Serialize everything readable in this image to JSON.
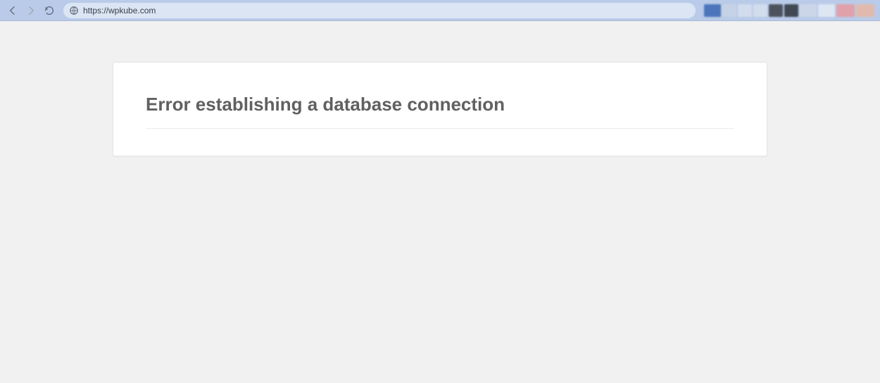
{
  "browser": {
    "url": "https://wpkube.com",
    "nav": {
      "back_label": "Back",
      "forward_label": "Forward",
      "reload_label": "Reload"
    },
    "extensions": [
      {
        "width": 24,
        "color": "#3a67b5"
      },
      {
        "width": 20,
        "color": "#c9d4e6"
      },
      {
        "width": 20,
        "color": "#d6dfee"
      },
      {
        "width": 20,
        "color": "#d6dfee"
      },
      {
        "width": 20,
        "color": "#3b3f46"
      },
      {
        "width": 20,
        "color": "#2d323a"
      },
      {
        "width": 24,
        "color": "#cfd8e8"
      },
      {
        "width": 24,
        "color": "#e4ebf5"
      },
      {
        "width": 26,
        "color": "#e89aa0"
      },
      {
        "width": 26,
        "color": "#e9b7a4"
      }
    ]
  },
  "page": {
    "error_title": "Error establishing a database connection"
  }
}
